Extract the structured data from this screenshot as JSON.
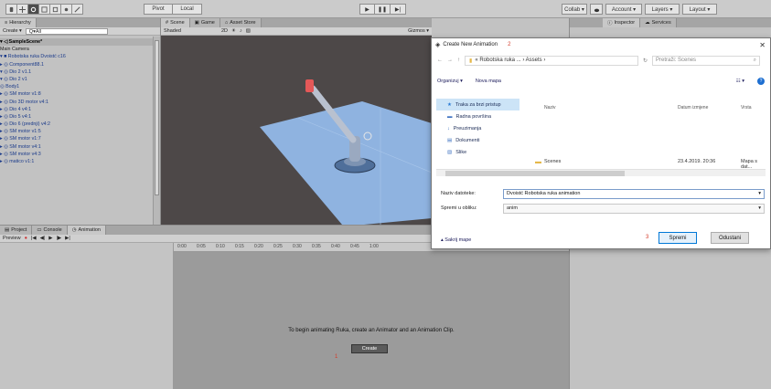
{
  "toolbar": {
    "play_label": "▶",
    "pause_label": "❚❚",
    "step_label": "▶|",
    "pivot_label": "Pivot",
    "local_label": "Local",
    "collab_label": "Collab ▾",
    "account_label": "Account ▾",
    "layers_label": "Layers ▾",
    "layout_label": "Layout ▾"
  },
  "hierarchy": {
    "tab_label": "Hierarchy",
    "create_label": "Create ▾",
    "search_placeholder": "Q▾All",
    "items": [
      "▾ ◁ SampleScene*",
      "   Main Camera",
      "  ▾ ■ Robotska ruka Dvoistć c16",
      "    ▸ ◎ Component88.1",
      "    ▾ ◎ Dio 2 v1.1",
      "       ▾ ◎ Dio 2 v1",
      "            ◎ Body1",
      "          ▸ ◎ SM motor v1:8",
      "    ▸ ◎ Dio 3D motor v4:1",
      "    ▸ ◎ Dio 4 v4:1",
      "    ▸ ◎ Dio 5 v4:1",
      "    ▸ ◎ Dio 6 (prednji) v4:2",
      "    ▸ ◎ SM motor v1:5",
      "    ▸ ◎ SM motor v1:7",
      "    ▸ ◎ SM motor v4:1",
      "    ▸ ◎ SM motor v4:3",
      "    ▸ ◎ matico v1:1"
    ]
  },
  "scene": {
    "tabs": [
      "Scene",
      "Game",
      "Asset Store"
    ],
    "shading_label": "Shaded",
    "mode_label": "2D",
    "gizmos_label": "Gizmos ▾"
  },
  "animation": {
    "tabs": [
      "Project",
      "Console",
      "Animation"
    ],
    "preview_label": "Preview",
    "ticks": [
      "0:00",
      "0:05",
      "0:10",
      "0:15",
      "0:20",
      "0:25",
      "0:30",
      "0:35",
      "0:40",
      "0:45",
      "1:00"
    ],
    "message": "To begin animating Ruka, create an Animator and an Animation Clip.",
    "create_label": "Create"
  },
  "inspector": {
    "tabs": [
      "Inspector",
      "Services"
    ]
  },
  "dialog": {
    "title": "Create New Animation",
    "close": "✕",
    "breadcrumb": "« Robotska ruka ... › Assets ›",
    "refresh": "↻",
    "search_placeholder": "Pretraži: Scenes",
    "organize_label": "Organizuj ▾",
    "new_folder_label": "Nova mapa",
    "nav_items": [
      "Traka za brzi pristup",
      "Radna površina",
      "Preuzimanja",
      "Dokumenti",
      "Slike"
    ],
    "columns": [
      "Naziv",
      "Datum izmjene",
      "Vrsta"
    ],
    "file_name": "Scenes",
    "file_date": "23.4.2019. 20:36",
    "file_type": "Mapa s dat...",
    "filename_label": "Naziv datoteke:",
    "filename_value": "Dvoistć Robotska ruka animation",
    "savetype_label": "Spremi u obliku:",
    "savetype_value": "anim",
    "hide_folders_label": "▴ Sakrij mape",
    "save_label": "Spremi",
    "cancel_label": "Odustani",
    "markers": [
      "2",
      "3",
      "1"
    ]
  },
  "colors": {
    "accent": "#0078d7",
    "selection": "#cce4f7",
    "marker": "#d43b2a",
    "ground": "#8fb3e0"
  }
}
